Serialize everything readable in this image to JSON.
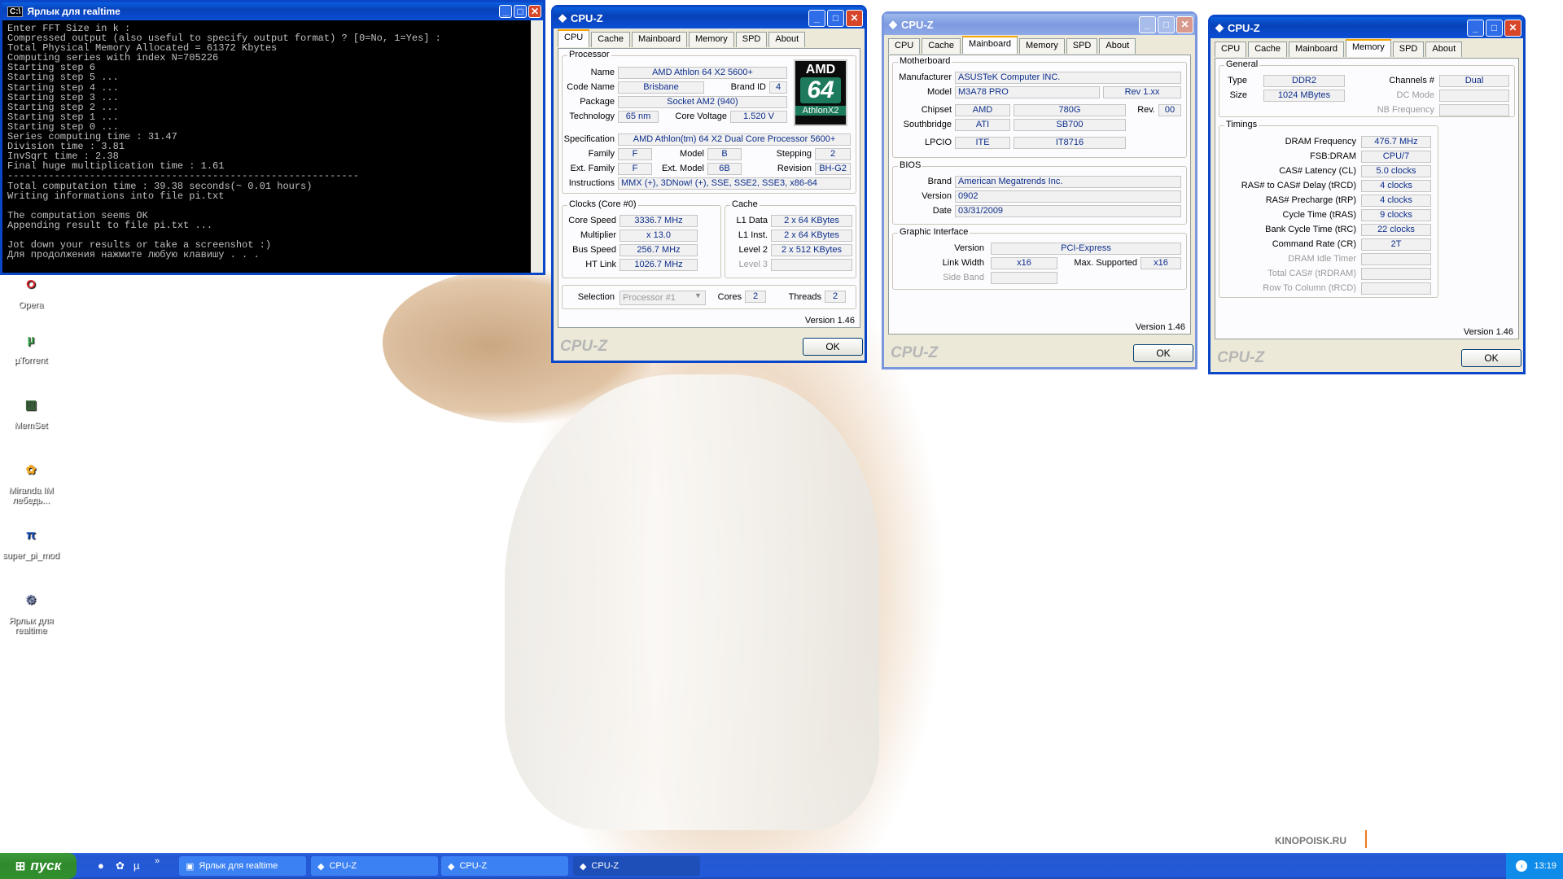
{
  "desktop": {
    "icons": [
      {
        "label": "Opera",
        "glyph": "O",
        "color": "#d9232b"
      },
      {
        "label": "µTorrent",
        "glyph": "µ",
        "color": "#3aa94b"
      },
      {
        "label": "MemSet",
        "glyph": "▥",
        "color": "#3a6a3a"
      },
      {
        "label": "Miranda IM лебедь...",
        "glyph": "✿",
        "color": "#f1a623"
      },
      {
        "label": "super_pi_mod",
        "glyph": "π",
        "color": "#1a55c8"
      },
      {
        "label": "Ярлык для realtime",
        "glyph": "⚙",
        "color": "#6b7ba8"
      }
    ],
    "watermark": "KINOPOISK.RU"
  },
  "console": {
    "title": "Ярлык для realtime",
    "lines": [
      "Enter FFT Size in k :",
      "Compressed output (also useful to specify output format) ? [0=No, 1=Yes] :",
      "Total Physical Memory Allocated = 61372 Kbytes",
      "Computing series with index N=705226",
      "Starting step 6",
      "Starting step 5 ...",
      "Starting step 4 ...",
      "Starting step 3 ...",
      "Starting step 2 ...",
      "Starting step 1 ...",
      "Starting step 0 ...",
      "Series computing time : 31.47",
      "Division time : 3.81",
      "InvSqrt time : 2.38",
      "Final huge multiplication time : 1.61",
      "------------------------------------------------------------",
      "Total computation time : 39.38 seconds(~ 0.01 hours)",
      "Writing informations into file pi.txt",
      "",
      "The computation seems OK",
      "Appending result to file pi.txt ...",
      "",
      "Jot down your results or take a screenshot :)",
      "Для продолжения нажмите любую клавишу . . ."
    ]
  },
  "cpuz": {
    "title": "CPU-Z",
    "tabs": [
      "CPU",
      "Cache",
      "Mainboard",
      "Memory",
      "SPD",
      "About"
    ],
    "brand": "CPU-Z",
    "version": "Version 1.46",
    "ok": "OK",
    "cpu": {
      "processor_label": "Processor",
      "name_l": "Name",
      "name": "AMD Athlon 64 X2 5600+",
      "code_l": "Code Name",
      "code": "Brisbane",
      "brandid_l": "Brand ID",
      "brandid": "4",
      "package_l": "Package",
      "package": "Socket AM2 (940)",
      "tech_l": "Technology",
      "tech": "65 nm",
      "cv_l": "Core Voltage",
      "cv": "1.520 V",
      "spec_l": "Specification",
      "spec": "AMD Athlon(tm) 64 X2 Dual Core Processor 5600+",
      "family_l": "Family",
      "family": "F",
      "model_l": "Model",
      "model": "B",
      "stepping_l": "Stepping",
      "stepping": "2",
      "extfam_l": "Ext. Family",
      "extfam": "F",
      "extmod_l": "Ext. Model",
      "extmod": "6B",
      "rev_l": "Revision",
      "rev": "BH-G2",
      "instr_l": "Instructions",
      "instr": "MMX (+), 3DNow! (+), SSE, SSE2, SSE3, x86-64",
      "logo_top": "AMD",
      "logo_mid": "64",
      "logo_bot": "AthlonX2",
      "clocks_label": "Clocks (Core #0)",
      "cs_l": "Core Speed",
      "cs": "3336.7 MHz",
      "mult_l": "Multiplier",
      "mult": "x 13.0",
      "bus_l": "Bus Speed",
      "bus": "256.7 MHz",
      "ht_l": "HT Link",
      "ht": "1026.7 MHz",
      "cache_label": "Cache",
      "l1d_l": "L1 Data",
      "l1d": "2 x 64 KBytes",
      "l1i_l": "L1 Inst.",
      "l1i": "2 x 64 KBytes",
      "l2_l": "Level 2",
      "l2": "2 x 512 KBytes",
      "l3_l": "Level 3",
      "l3": "",
      "sel_l": "Selection",
      "sel": "Processor #1",
      "cores_l": "Cores",
      "cores": "2",
      "threads_l": "Threads",
      "threads": "2"
    },
    "mainboard": {
      "mb_label": "Motherboard",
      "manu_l": "Manufacturer",
      "manu": "ASUSTeK Computer INC.",
      "model_l": "Model",
      "model": "M3A78 PRO",
      "model_rev": "Rev 1.xx",
      "chipset_l": "Chipset",
      "chipset_a": "AMD",
      "chipset_b": "780G",
      "rev_l": "Rev.",
      "rev": "00",
      "sb_l": "Southbridge",
      "sb_a": "ATI",
      "sb_b": "SB700",
      "lpcio_l": "LPCIO",
      "lpcio_a": "ITE",
      "lpcio_b": "IT8716",
      "bios_label": "BIOS",
      "brand_l": "Brand",
      "brand": "American Megatrends Inc.",
      "ver_l": "Version",
      "ver": "0902",
      "date_l": "Date",
      "date": "03/31/2009",
      "gi_label": "Graphic Interface",
      "giver_l": "Version",
      "giver": "PCI-Express",
      "lw_l": "Link Width",
      "lw": "x16",
      "ms_l": "Max. Supported",
      "ms": "x16",
      "sideband_l": "Side Band"
    },
    "memory": {
      "gen_label": "General",
      "type_l": "Type",
      "type": "DDR2",
      "ch_l": "Channels #",
      "ch": "Dual",
      "size_l": "Size",
      "size": "1024 MBytes",
      "dc_l": "DC Mode",
      "nb_l": "NB Frequency",
      "tim_label": "Timings",
      "timings": [
        {
          "l": "DRAM Frequency",
          "v": "476.7 MHz"
        },
        {
          "l": "FSB:DRAM",
          "v": "CPU/7"
        },
        {
          "l": "CAS# Latency (CL)",
          "v": "5.0 clocks"
        },
        {
          "l": "RAS# to CAS# Delay (tRCD)",
          "v": "4 clocks"
        },
        {
          "l": "RAS# Precharge (tRP)",
          "v": "4 clocks"
        },
        {
          "l": "Cycle Time (tRAS)",
          "v": "9 clocks"
        },
        {
          "l": "Bank Cycle Time (tRC)",
          "v": "22 clocks"
        },
        {
          "l": "Command Rate (CR)",
          "v": "2T"
        },
        {
          "l": "DRAM Idle Timer",
          "v": ""
        },
        {
          "l": "Total CAS# (tRDRAM)",
          "v": ""
        },
        {
          "l": "Row To Column (tRCD)",
          "v": ""
        }
      ]
    }
  },
  "taskbar": {
    "start": "пуск",
    "items": [
      "Ярлык для realtime",
      "CPU-Z",
      "CPU-Z",
      "CPU-Z"
    ],
    "clock": "13:19"
  }
}
